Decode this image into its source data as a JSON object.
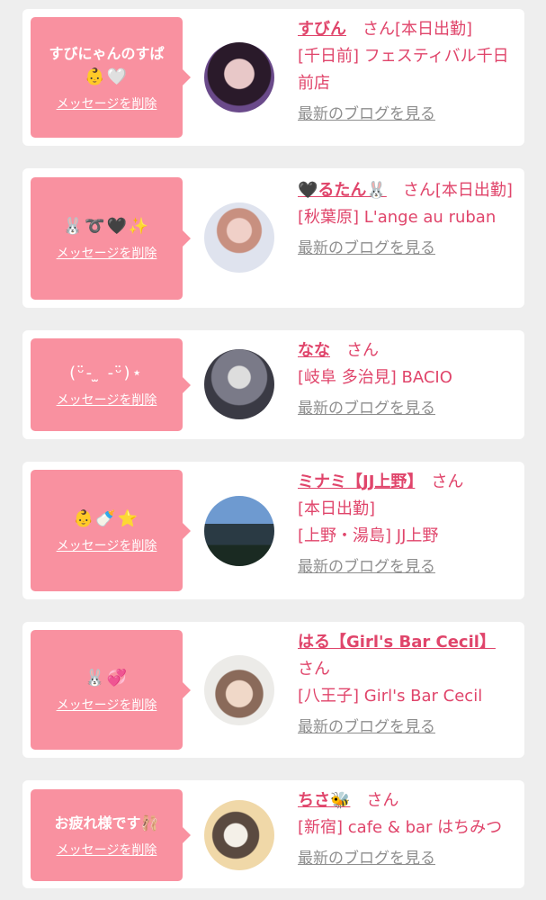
{
  "common": {
    "delete_label": "メッセージを削除",
    "blog_label": "最新のブログを見る",
    "honorific": "さん"
  },
  "cards": [
    {
      "message": "すびにゃんのすぱ",
      "emoji": "👶🤍",
      "name": "すびん",
      "status": "[本日出勤]",
      "shop": "[千日前] フェスティバル千日前店"
    },
    {
      "message": "",
      "emoji": "🐰➰🖤✨",
      "name": "🖤るたん🐰",
      "status": "[本日出勤]",
      "shop": "[秋葉原] L'ange au ruban"
    },
    {
      "message": "",
      "emoji": "(ᵕ̈- ̫ -ᵕ̈)⋆",
      "name": "なな",
      "status": "",
      "shop": "[岐阜 多治見] BACIO"
    },
    {
      "message": "",
      "emoji": "👶🍼⭐",
      "name": "ミナミ【JJ上野】",
      "status": "[本日出勤]",
      "shop": "[上野・湯島] JJ上野"
    },
    {
      "message": "",
      "emoji": "🐰💞",
      "name": "はる【Girl's Bar Cecil】",
      "status": "",
      "shop": "[八王子] Girl's Bar Cecil"
    },
    {
      "message": "お疲れ様です🩰",
      "emoji": "",
      "name": "ちさ🐝",
      "status": "",
      "shop": "[新宿] cafe & bar はちみつ"
    }
  ]
}
